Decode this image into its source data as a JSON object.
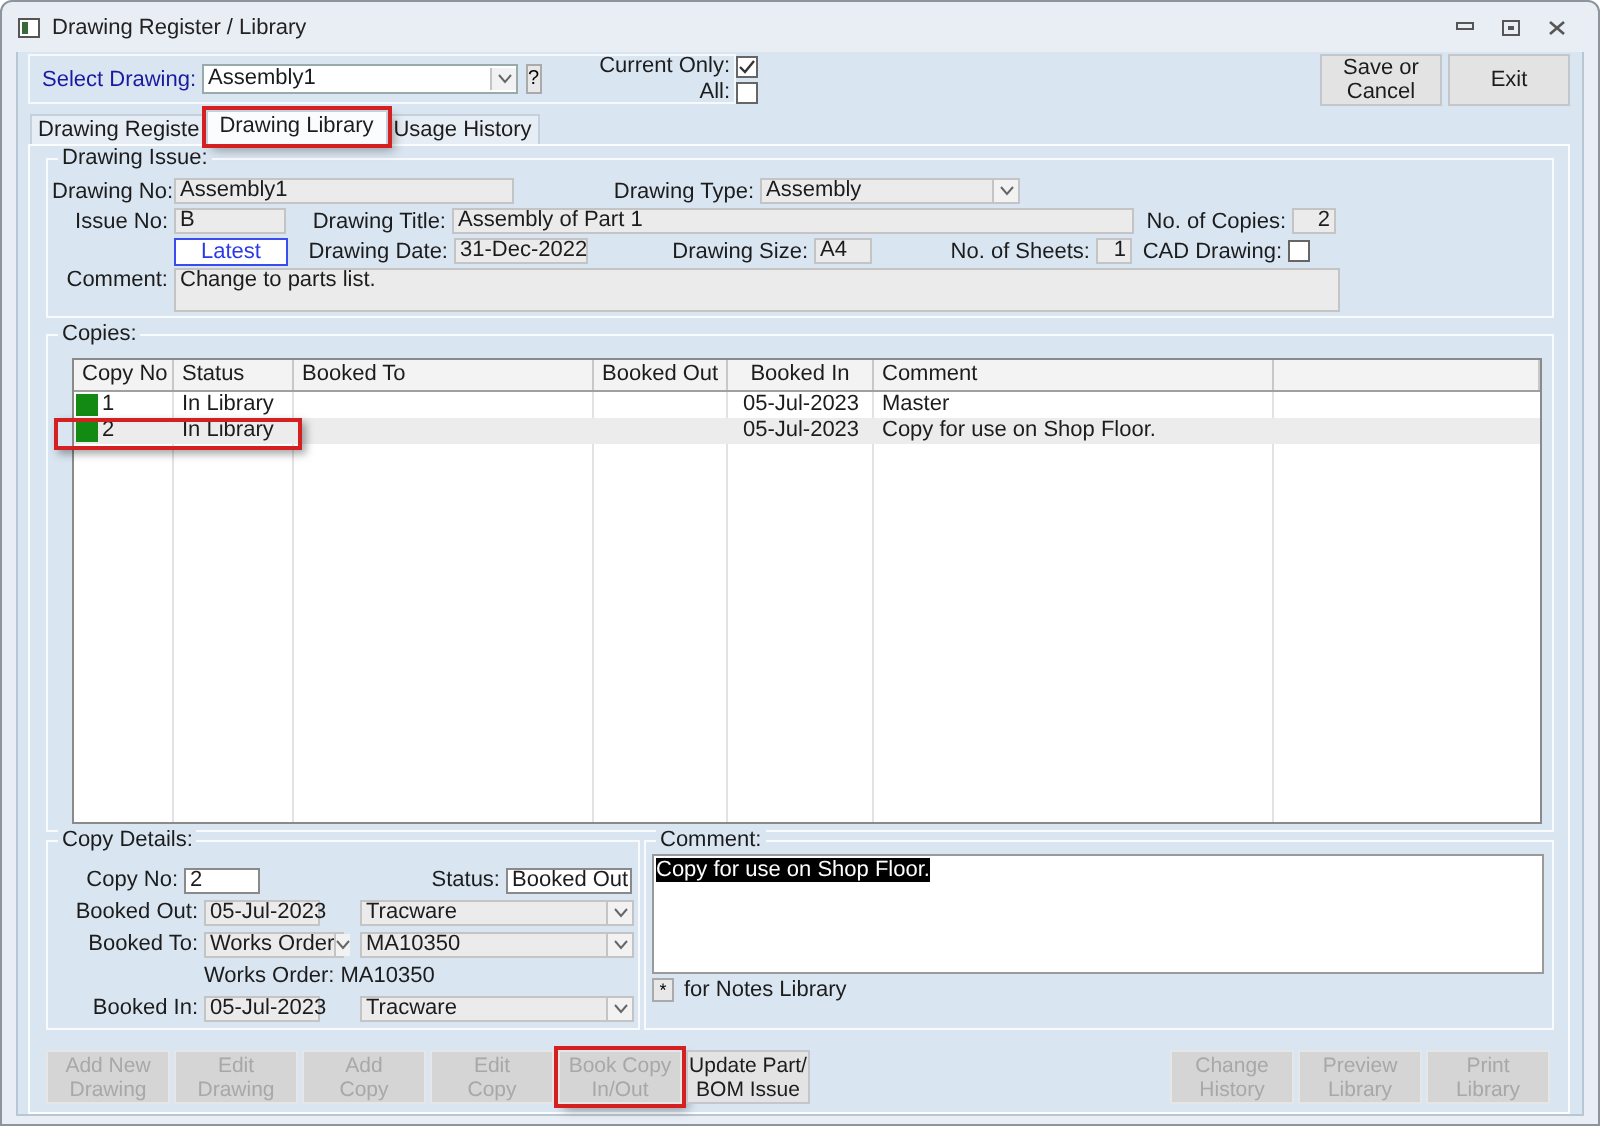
{
  "window": {
    "title": "Drawing Register / Library"
  },
  "selector": {
    "label": "Select Drawing:",
    "value": "Assembly1",
    "help": "?",
    "current_only": {
      "label": "Current Only:",
      "checked": true
    },
    "all": {
      "label": "All:",
      "checked": false
    }
  },
  "top_buttons": [
    {
      "lines": [
        "Save or",
        "Cancel"
      ]
    },
    {
      "lines": [
        "Exit"
      ]
    }
  ],
  "tabs": [
    {
      "label": "Drawing Registe",
      "selected": false,
      "highlighted": false
    },
    {
      "label": "Drawing Library",
      "selected": true,
      "highlighted": true
    },
    {
      "label": "Usage History",
      "selected": false,
      "highlighted": false
    }
  ],
  "drawing_issue": {
    "title": "Drawing Issue:",
    "drawing_no": {
      "label": "Drawing No:",
      "value": "Assembly1"
    },
    "drawing_type": {
      "label": "Drawing Type:",
      "value": "Assembly"
    },
    "issue_no": {
      "label": "Issue No:",
      "value": "B"
    },
    "latest": "Latest",
    "drawing_title": {
      "label": "Drawing Title:",
      "value": "Assembly of Part 1"
    },
    "no_of_copies": {
      "label": "No. of Copies:",
      "value": "2"
    },
    "drawing_date": {
      "label": "Drawing Date:",
      "value": "31-Dec-2022"
    },
    "drawing_size": {
      "label": "Drawing Size:",
      "value": "A4"
    },
    "no_of_sheets": {
      "label": "No. of Sheets:",
      "value": "1"
    },
    "cad_drawing": {
      "label": "CAD Drawing:",
      "checked": false
    },
    "comment": {
      "label": "Comment:",
      "value": "Change to parts list."
    }
  },
  "copies": {
    "title": "Copies:",
    "columns": [
      "Copy No",
      "Status",
      "Booked To",
      "Booked Out",
      "Booked In",
      "Comment"
    ],
    "rows": [
      {
        "color": "#138a13",
        "copy_no": "1",
        "status": "In Library",
        "booked_in": "05-Jul-2023",
        "comment": "Master",
        "selected": false,
        "highlighted": false
      },
      {
        "color": "#138a13",
        "copy_no": "2",
        "status": "In Library",
        "booked_in": "05-Jul-2023",
        "comment": "Copy for use on Shop Floor.",
        "selected": true,
        "highlighted": true
      }
    ]
  },
  "copy_details": {
    "title": "Copy Details:",
    "copy_no": {
      "label": "Copy No:",
      "value": "2"
    },
    "status": {
      "label": "Status:",
      "value": "Booked Out"
    },
    "booked_out": {
      "label": "Booked Out:",
      "date": "05-Jul-2023",
      "by": "Tracware"
    },
    "booked_to": {
      "label": "Booked To:",
      "type": "Works Order",
      "ref": "MA10350"
    },
    "works_order": "Works Order: MA10350",
    "booked_in": {
      "label": "Booked In:",
      "date": "05-Jul-2023",
      "by": "Tracware"
    }
  },
  "comment": {
    "title": "Comment:",
    "text": "Copy for use on Shop Floor.",
    "text_selected": true,
    "notes_button": "*",
    "notes_label": "for Notes Library"
  },
  "left_buttons": [
    {
      "lines": [
        "Add New",
        "Drawing"
      ],
      "disabled": true,
      "highlighted": false
    },
    {
      "lines": [
        "Edit",
        "Drawing"
      ],
      "disabled": true,
      "highlighted": false
    },
    {
      "lines": [
        "Add",
        "Copy"
      ],
      "disabled": true,
      "highlighted": false
    },
    {
      "lines": [
        "Edit",
        "Copy"
      ],
      "disabled": true,
      "highlighted": false
    },
    {
      "lines": [
        "Book Copy",
        "In/Out"
      ],
      "disabled": true,
      "highlighted": true
    },
    {
      "lines": [
        "Update Part/",
        "BOM Issue"
      ],
      "disabled": false,
      "highlighted": false
    }
  ],
  "right_buttons": [
    {
      "lines": [
        "Change",
        "History"
      ],
      "disabled": true,
      "highlighted": false
    },
    {
      "lines": [
        "Preview",
        "Library"
      ],
      "disabled": true,
      "highlighted": false
    },
    {
      "lines": [
        "Print",
        "Library"
      ],
      "disabled": true,
      "highlighted": false
    }
  ]
}
